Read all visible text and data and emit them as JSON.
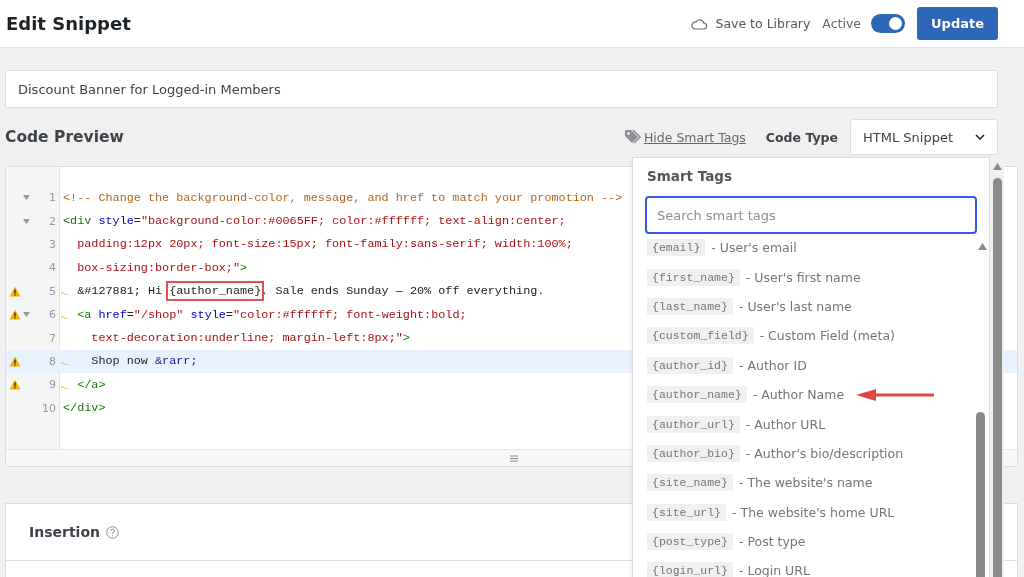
{
  "header": {
    "title": "Edit Snippet",
    "save_label": "Save to Library",
    "active_label": "Active",
    "active_toggle": {
      "on": true
    },
    "update_button": "Update"
  },
  "snippet_title": {
    "value": "Discount Banner for Logged-in Members"
  },
  "code_preview": {
    "title": "Code Preview",
    "smart_tags_link": "Hide Smart Tags",
    "code_type_label": "Code Type",
    "code_type_value": "HTML Snippet",
    "lines": [
      {
        "number": "1",
        "fold": true,
        "warning": false,
        "current": false,
        "tokens": [
          {
            "kind": "comment",
            "text": "<!-- Change the background-color, message, and href to match your promotion -->"
          }
        ]
      },
      {
        "number": "2",
        "fold": true,
        "warning": false,
        "current": false,
        "tokens": [
          {
            "kind": "tag",
            "text": "<div"
          },
          {
            "kind": "attr",
            "text": " style"
          },
          {
            "kind": "text",
            "text": "="
          },
          {
            "kind": "string",
            "text": "\"background-color:#0065FF; color:#ffffff; text-align:center;"
          }
        ]
      },
      {
        "number": "3",
        "fold": false,
        "warning": false,
        "current": false,
        "tokens": [
          {
            "kind": "string",
            "text": "  padding:12px 20px; font-size:15px; font-family:sans-serif; width:100%;"
          }
        ]
      },
      {
        "number": "4",
        "fold": false,
        "warning": false,
        "current": false,
        "tokens": [
          {
            "kind": "string",
            "text": "  box-sizing:border-box;\""
          },
          {
            "kind": "tag",
            "text": ">"
          }
        ]
      },
      {
        "number": "5",
        "fold": false,
        "warning": true,
        "current": false,
        "tokens": [
          {
            "kind": "text",
            "text": "  &#127881; Hi "
          },
          {
            "kind": "text",
            "text": "{author_name}",
            "boxed": true
          },
          {
            "kind": "text",
            "text": ", Sale ends Sunday — 20% off everything."
          }
        ]
      },
      {
        "number": "6",
        "fold": true,
        "warning": true,
        "current": false,
        "tokens": [
          {
            "kind": "tag",
            "text": "  <a"
          },
          {
            "kind": "attr",
            "text": " href"
          },
          {
            "kind": "text",
            "text": "="
          },
          {
            "kind": "string",
            "text": "\"/shop\""
          },
          {
            "kind": "attr",
            "text": " style"
          },
          {
            "kind": "text",
            "text": "="
          },
          {
            "kind": "string",
            "text": "\"color:#ffffff; font-weight:bold;"
          }
        ]
      },
      {
        "number": "7",
        "fold": false,
        "warning": false,
        "current": false,
        "tokens": [
          {
            "kind": "string",
            "text": "    text-decoration:underline; margin-left:8px;\""
          },
          {
            "kind": "tag",
            "text": ">"
          }
        ]
      },
      {
        "number": "8",
        "fold": false,
        "warning": true,
        "current": true,
        "tokens": [
          {
            "kind": "text",
            "text": "    Shop now "
          },
          {
            "kind": "entity",
            "text": "&rarr;"
          }
        ]
      },
      {
        "number": "9",
        "fold": false,
        "warning": true,
        "current": false,
        "tokens": [
          {
            "kind": "tag",
            "text": "  </a>"
          }
        ]
      },
      {
        "number": "10",
        "fold": false,
        "warning": false,
        "current": false,
        "tokens": [
          {
            "kind": "tag",
            "text": "</div>"
          }
        ]
      }
    ]
  },
  "insertion": {
    "title": "Insertion"
  },
  "smart_tags_panel": {
    "title": "Smart Tags",
    "search": {
      "placeholder": "Search smart tags"
    },
    "items": [
      {
        "tag": "{email}",
        "description": "- User's email",
        "pointer": false
      },
      {
        "tag": "{first_name}",
        "description": "- User's first name",
        "pointer": false
      },
      {
        "tag": "{last_name}",
        "description": "- User's last name",
        "pointer": false
      },
      {
        "tag": "{custom_field}",
        "description": "- Custom Field (meta)",
        "pointer": false
      },
      {
        "tag": "{author_id}",
        "description": "- Author ID",
        "pointer": false
      },
      {
        "tag": "{author_name}",
        "description": "- Author Name",
        "pointer": true
      },
      {
        "tag": "{author_url}",
        "description": "- Author URL",
        "pointer": false
      },
      {
        "tag": "{author_bio}",
        "description": "- Author's bio/description",
        "pointer": false
      },
      {
        "tag": "{site_name}",
        "description": "- The website's name",
        "pointer": false
      },
      {
        "tag": "{site_url}",
        "description": "- The website's home URL",
        "pointer": false
      },
      {
        "tag": "{post_type}",
        "description": "- Post type",
        "pointer": false
      },
      {
        "tag": "{login_url}",
        "description": "- Login URL",
        "pointer": false
      }
    ]
  }
}
